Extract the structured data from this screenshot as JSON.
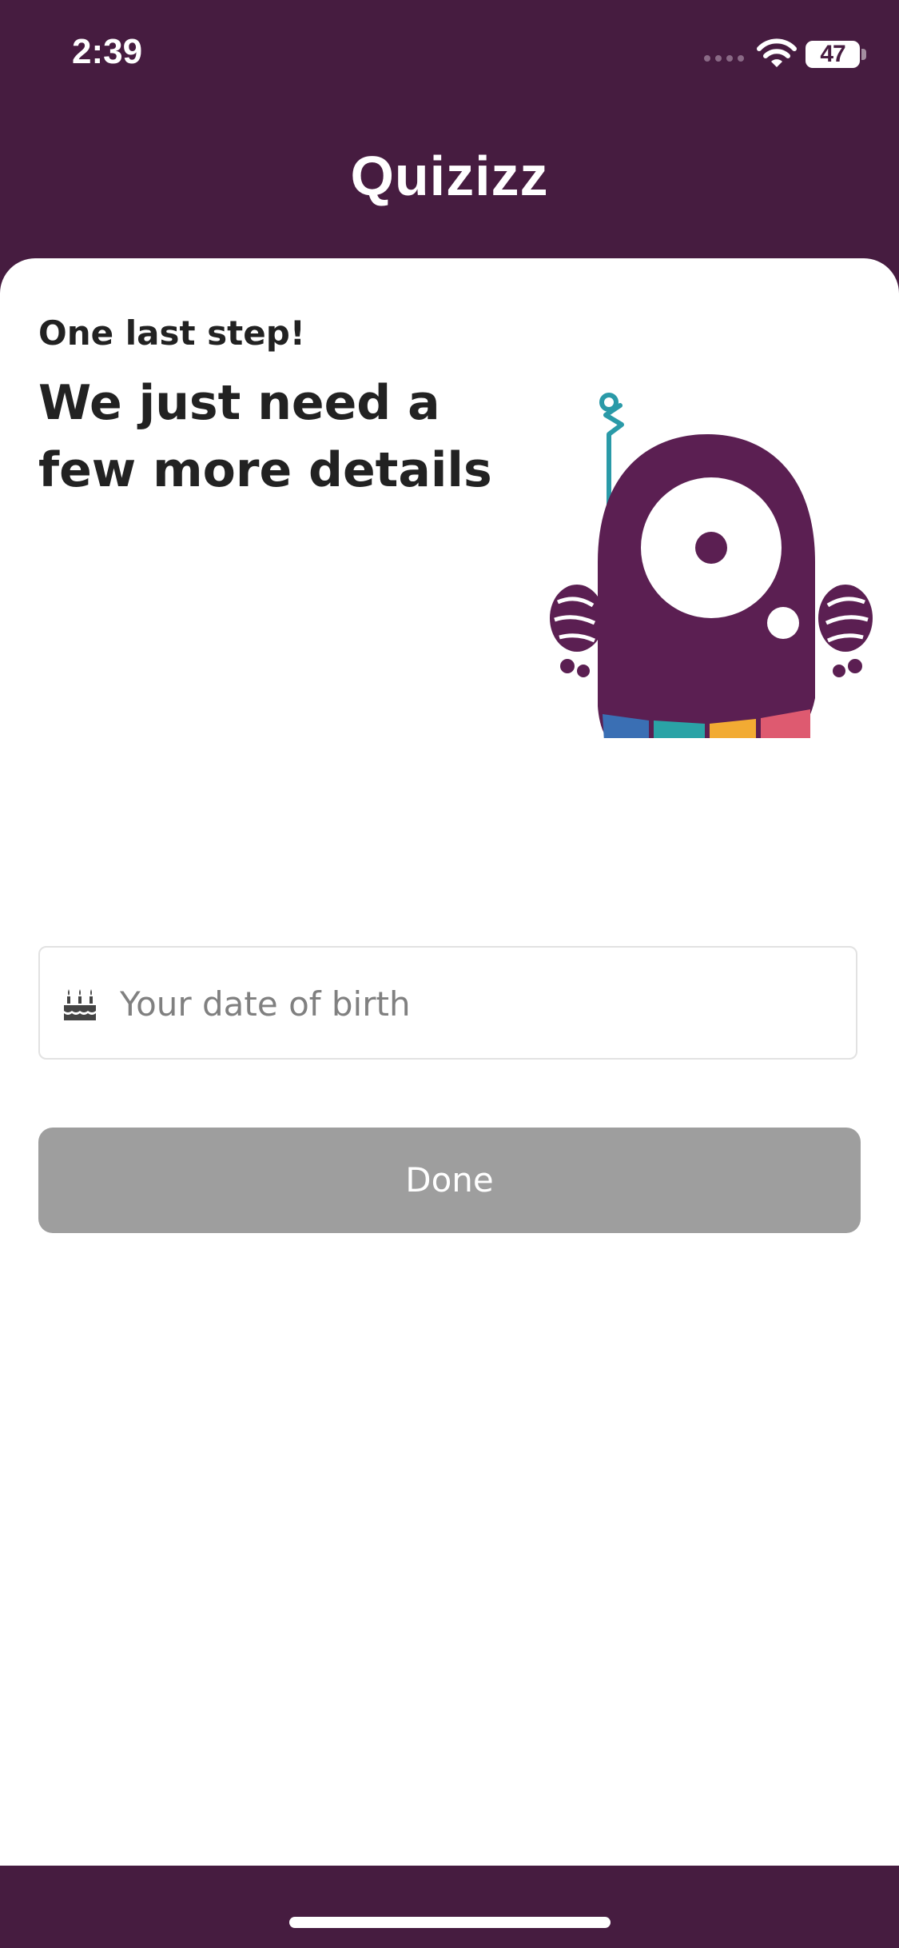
{
  "status_bar": {
    "time": "2:39",
    "battery": "47",
    "icons": [
      "signal-icon",
      "wifi-icon",
      "battery-icon"
    ]
  },
  "header": {
    "logo_text": "Quizizz",
    "background_color": "#461c40"
  },
  "content": {
    "subtitle": "One last step!",
    "title": "We just need a few more details",
    "illustration": "quizizz-monster-mascot"
  },
  "form": {
    "dob": {
      "value": "",
      "placeholder": "Your date of birth",
      "icon": "cake-icon"
    },
    "done_label": "Done",
    "done_color": "#9e9e9e"
  }
}
